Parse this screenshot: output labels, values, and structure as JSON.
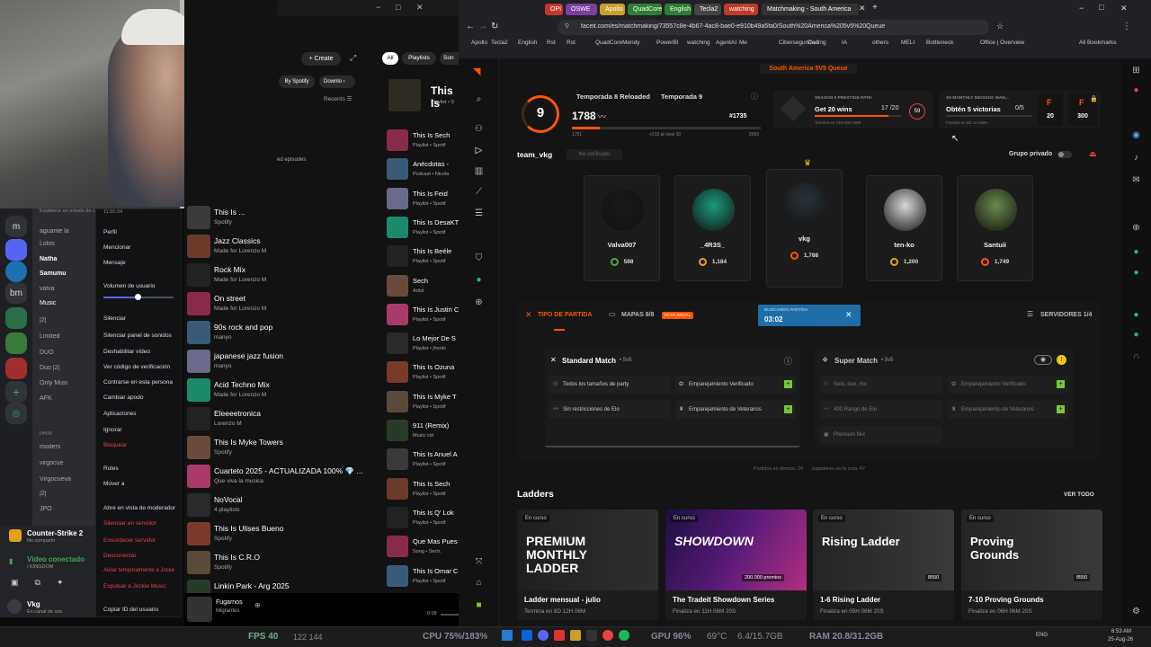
{
  "webcam": {},
  "discord": {
    "servers": [
      "m",
      "bm"
    ],
    "channels": [
      "aguante la",
      "Lolos",
      "Natha",
      "Samumu",
      "valva",
      "Music",
      "|2|",
      "Limited",
      "DUO",
      "Duo |2|",
      "Only Musi",
      "AFK",
      "moders",
      "virgocue",
      "Virgocueva",
      "|2|",
      "JPO"
    ],
    "channel_header": "PRIV",
    "context_menu": [
      {
        "label": "Perfil",
        "red": false
      },
      {
        "label": "Mencionar",
        "red": false
      },
      {
        "label": "Mensaje",
        "red": false
      },
      {
        "label": "Volumen de usuario",
        "red": false
      },
      {
        "label": "Silenciar",
        "red": false
      },
      {
        "label": "Silenciar panel de sonidos",
        "red": false
      },
      {
        "label": "Deshabilitar vídeo",
        "red": false
      },
      {
        "label": "Ver código de verificación",
        "red": false
      },
      {
        "label": "Contrarse en esta persona",
        "red": false
      },
      {
        "label": "Cambiar apodo",
        "red": false
      },
      {
        "label": "Aplicaciones",
        "red": false
      },
      {
        "label": "Ignorar",
        "red": false
      },
      {
        "label": "Bloquear",
        "red": true
      },
      {
        "label": "Roles",
        "red": false
      },
      {
        "label": "Mover a",
        "red": false
      },
      {
        "label": "Abre en vista de moderador",
        "red": false
      },
      {
        "label": "Silenciar en servidor",
        "red": true
      },
      {
        "label": "Ensordecer servidor",
        "red": true
      },
      {
        "label": "Desconectar",
        "red": true
      },
      {
        "label": "Aislar temporalmente a Jocke",
        "red": true
      },
      {
        "label": "Expulsar a Jockie Music",
        "red": true
      },
      {
        "label": "Copiar ID del usuario",
        "red": false
      }
    ],
    "game": "Counter-Strike 2",
    "game_sub": "No compartir",
    "voice": "Vídeo conectado",
    "voice_sub": "/ KINGDOM",
    "user": "Vkg",
    "user_sub": "En canal de vos",
    "time": "11:55:34",
    "status_hint": "Establece un estado de canal"
  },
  "spotify": {
    "create": "Create",
    "filters": [
      "All",
      "Playlists",
      "Son"
    ],
    "by_spotify": "By Spotify",
    "downloads": "Downlo",
    "recents": "Recents",
    "left_items": [
      {
        "t": "This Is ...",
        "s": "Spotify"
      },
      {
        "t": "Jazz Classics",
        "s": "Made for Lorenzo M"
      },
      {
        "t": "Rock Mix",
        "s": "Made for Lorenzo M"
      },
      {
        "t": "On street",
        "s": "Made for Lorenzo M"
      },
      {
        "t": "90s rock and pop",
        "s": "manyo"
      },
      {
        "t": "japanese jazz fusion",
        "s": "manyo"
      },
      {
        "t": "Acid Techno Mix",
        "s": "Made for Lorenzo M"
      },
      {
        "t": "Eleeeetronica",
        "s": "Lorenzo M"
      },
      {
        "t": "This Is Myke Towers",
        "s": "Spotify"
      },
      {
        "t": "Cuarteto 2025 - ACTUALIZADA 100% 💎 ...",
        "s": "Que viva la musica"
      },
      {
        "t": "NoVocal",
        "s": "4 playlists"
      },
      {
        "t": "This Is Ulises Bueno",
        "s": "Spotify"
      },
      {
        "t": "This Is C.R.O",
        "s": "Spotify"
      },
      {
        "t": "Linkin Park - Arg 2025",
        "s": ""
      }
    ],
    "right_items": [
      {
        "t": "This Is Sech",
        "s": "Playlist • Spotif"
      },
      {
        "t": "Anécdotas -",
        "s": "Podcast • Nicola"
      },
      {
        "t": "This Is Feid",
        "s": "Playlist • Spotif"
      },
      {
        "t": "This Is DesaKT",
        "s": "Playlist • Spotif"
      },
      {
        "t": "This Is Beéle",
        "s": "Playlist • Spotif"
      },
      {
        "t": "Sech",
        "s": "Artist"
      },
      {
        "t": "This Is Justin C",
        "s": "Playlist • Spotif"
      },
      {
        "t": "Lo Mejor De S",
        "s": "Playlist • jhonlo"
      },
      {
        "t": "This Is Ozuna",
        "s": "Playlist • Spotif"
      },
      {
        "t": "This Is Myke T",
        "s": "Playlist • Spotif"
      },
      {
        "t": "911 (Remix)",
        "s": "Music vid"
      },
      {
        "t": "This Is Anuel A",
        "s": "Playlist • Spotif"
      },
      {
        "t": "This Is Sech",
        "s": "Playlist • Spotif"
      },
      {
        "t": "This Is Q' Lok",
        "s": "Playlist • Spotif"
      },
      {
        "t": "Que Mas Pues",
        "s": "Song • Sech,"
      },
      {
        "t": "This Is Omar C",
        "s": "Playlist • Spotif"
      }
    ],
    "hero_title": "This Is",
    "hero_sub": "Playlist • S",
    "episodes": "ed episodes",
    "now_playing": "Fugarnos",
    "now_artist": "Migrantes",
    "time": "0:09"
  },
  "chrome": {
    "tabs": [
      {
        "label": "OPI 2.0",
        "color": "#c0392b"
      },
      {
        "label": "OSWE",
        "color": "#7b3fa0"
      },
      {
        "label": "Apollo",
        "color": "#c8a02a"
      },
      {
        "label": "QuadCore",
        "color": "#2e7d32"
      },
      {
        "label": "English",
        "color": "#2e7d32"
      },
      {
        "label": "Tecla2",
        "color": "#444"
      },
      {
        "label": "watching",
        "color": "#c0392b"
      },
      {
        "label": "Matchmaking - South America",
        "color": "#333"
      }
    ],
    "url": "faceit.com/es/matchmaking/73557c8e-4b67-4ac8-bae0-e910b49a5fa0/South%20America%205v5%20Queue",
    "bookmarks": [
      "Apollo",
      "Tecla2",
      "English",
      "Rst",
      "Rst",
      "QuadCore",
      "Mendy",
      "PowerBI",
      "watching",
      "AgentAI",
      "Me",
      "Ciberseguridad",
      "Coding",
      "IA",
      "others",
      "MELI",
      "Bottleneck",
      "Office | Overview",
      "All Bookmarks"
    ]
  },
  "faceit": {
    "queue_title": "South America 5V5 Queue",
    "level": "9",
    "elo": "1788",
    "season_tabs": [
      "Temporada 8 Reloaded",
      "Temporada 9"
    ],
    "rank": "#1735",
    "elo_min": "1751",
    "elo_to_next": "+213 al nivel 10",
    "elo_max": "2000",
    "prestige_label": "SEASON 9 PRESTIGE PATH",
    "prestige_title": "Get 20 wins",
    "prestige_progress": "17 /20",
    "prestige_sub": "Termina en 74D 00H 08M",
    "prestige_points": "59",
    "mission_label": "S9 MONTHLY MISSION: MAN...",
    "mission_title": "Obtén 5 victorias",
    "mission_progress": "0/5",
    "mission_sub": "Finaliza en 6D 1H 06M",
    "reward1": "20",
    "reward2": "300",
    "team_name": "team_vkg",
    "team_status": "No verificado",
    "private_group": "Grupo privado",
    "players": [
      {
        "name": "Valva007",
        "elo": "598",
        "color": "#5ba33a",
        "av": "#1a1a1a"
      },
      {
        "name": "_4R3S_",
        "elo": "1,184",
        "color": "#e6a21a",
        "av": "#1b9a7b"
      },
      {
        "name": "vkg",
        "elo": "1,788",
        "color": "#ff5500",
        "av": "#2a3338"
      },
      {
        "name": "ten-ko",
        "elo": "1,200",
        "color": "#e6a21a",
        "av": "#d8d8d8"
      },
      {
        "name": "Santuii",
        "elo": "1,749",
        "color": "#ff5500",
        "av": "#6b8a4a"
      }
    ],
    "match_type": "TIPO DE PARTIDA",
    "maps": "MAPAS 8/8",
    "maps_badge": "MAPA INICIAL",
    "searching_label": "BUSCANDO PARTIDA",
    "searching_time": "03:02",
    "servers": "SERVIDORES 1/4",
    "standard_title": "Standard Match",
    "standard_mode": "• 5v5",
    "standard_opts": [
      "Todos los tamaños de party",
      "Emparejamiento Verificado",
      "Sin restricciones de Elo",
      "Emparejamiento de Veteranos"
    ],
    "super_title": "Super Match",
    "super_mode": "• 5v5",
    "super_opts": [
      "Solo, duo, trio",
      "Emparejamiento Verificado",
      "400 Rango de Elo",
      "Emparejamiento de Veteranos",
      "Premium flex"
    ],
    "footer_stats": "Partidos en directo: 24      Jugadores en la cola: 47",
    "ladders_title": "Ladders",
    "see_all": "VER TODO",
    "ladders": [
      {
        "badge": "En curso",
        "title": "Ladder mensual - julio",
        "sub": "Termina en 8D 12H 06M",
        "img": "PREMIUM MONTHLY LADDER"
      },
      {
        "badge": "En curso",
        "title": "The Tradeit Showdown Series",
        "sub": "Finaliza en 11H 06M 20S",
        "img": "SHOWDOWN",
        "prize": "200.000 premios"
      },
      {
        "badge": "En curso",
        "title": "1-6 Rising Ladder",
        "sub": "Finaliza en 05H 06M 20S",
        "img": "Rising Ladder",
        "pts": "8550"
      },
      {
        "badge": "En curso",
        "title": "7-10 Proving Grounds",
        "sub": "Finaliza en 06H 06M 20S",
        "img": "Proving Grounds",
        "pts": "8550"
      }
    ]
  },
  "taskbar": {
    "fps": "FPS 40",
    "fps_sub": "122 144",
    "cpu": "CPU 75%/183%",
    "gpu": "GPU 96%",
    "temp": "69°C",
    "gpumem": "6.4/15.7GB",
    "ram": "RAM 20.8/31.2GB",
    "lang": "ENG",
    "clock": "6:53 AM",
    "date": "25-Aug-26"
  }
}
